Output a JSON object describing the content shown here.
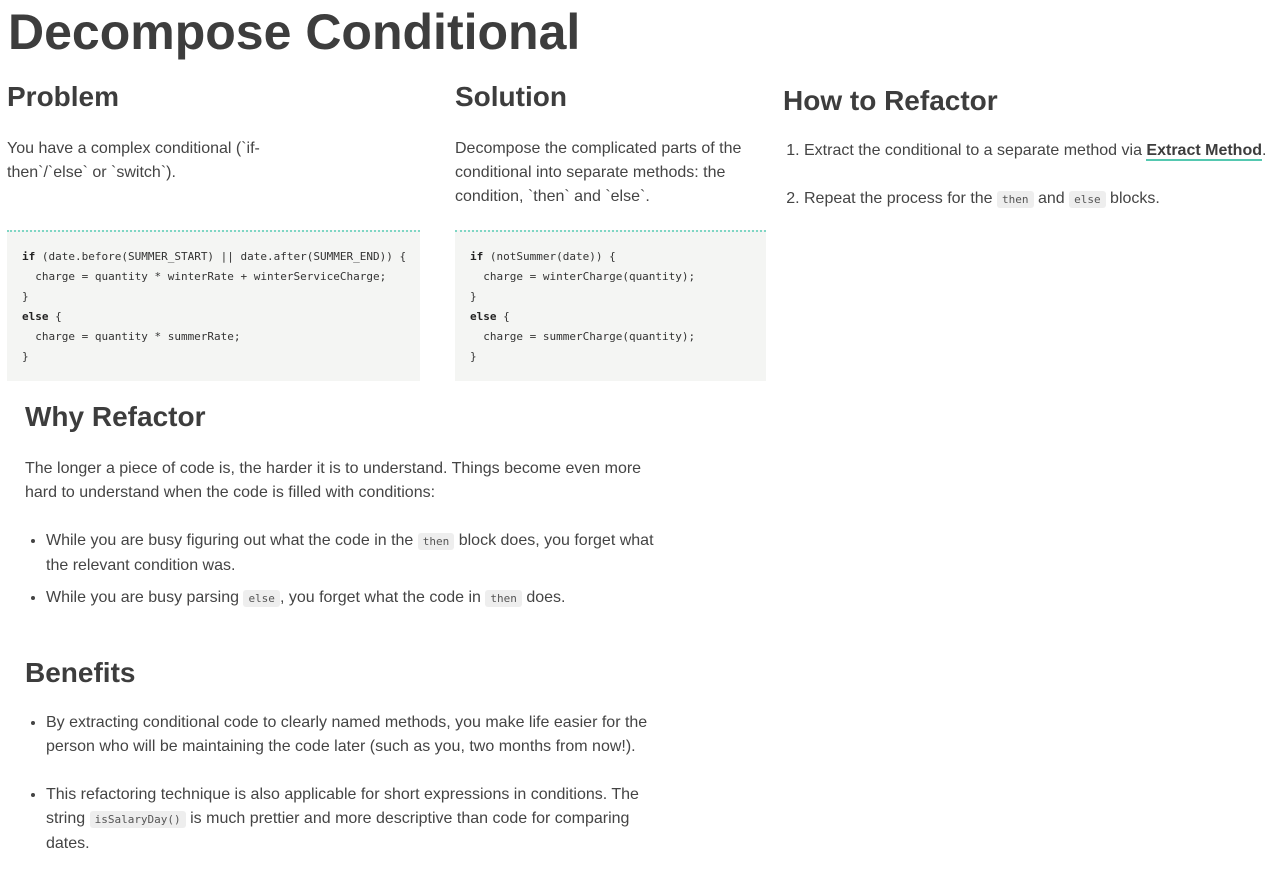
{
  "page_title": "Decompose Conditional",
  "problem": {
    "heading": "Problem",
    "text": "You have a complex conditional (`if-then`/`else` or `switch`).",
    "code": [
      {
        "kw": "if",
        "rest": " (date.before(SUMMER_START) || date.after(SUMMER_END)) {"
      },
      {
        "kw": "",
        "rest": "  charge = quantity * winterRate + winterServiceCharge;"
      },
      {
        "kw": "",
        "rest": "}"
      },
      {
        "kw": "else",
        "rest": " {"
      },
      {
        "kw": "",
        "rest": "  charge = quantity * summerRate;"
      },
      {
        "kw": "",
        "rest": "}"
      }
    ]
  },
  "solution": {
    "heading": "Solution",
    "text": "Decompose the complicated parts of the conditional into separate methods: the condition, `then` and `else`.",
    "code": [
      {
        "kw": "if",
        "rest": " (notSummer(date)) {"
      },
      {
        "kw": "",
        "rest": "  charge = winterCharge(quantity);"
      },
      {
        "kw": "",
        "rest": "}"
      },
      {
        "kw": "else",
        "rest": " {"
      },
      {
        "kw": "",
        "rest": "  charge = summerCharge(quantity);"
      },
      {
        "kw": "",
        "rest": "}"
      }
    ]
  },
  "how_to": {
    "heading": "How to Refactor",
    "step1_text": "Extract the conditional to a separate method via ",
    "step1_link": "Extract Method",
    "step1_end": ".",
    "step2_a": "Repeat the process for the ",
    "step2_code1": "then",
    "step2_b": " and ",
    "step2_code2": "else",
    "step2_c": " blocks."
  },
  "why": {
    "heading": "Why Refactor",
    "text": "The longer a piece of code is, the harder it is to understand. Things become even more hard to understand when the code is filled with conditions:",
    "b1_a": "While you are busy figuring out what the code in the ",
    "b1_code": "then",
    "b1_b": " block does, you forget what the relevant condition was.",
    "b2_a": "While you are busy parsing ",
    "b2_code1": "else",
    "b2_b": ", you forget what the code in ",
    "b2_code2": "then",
    "b2_c": " does."
  },
  "benefits": {
    "heading": "Benefits",
    "b1": "By extracting conditional code to clearly named methods, you make life easier for the person who will be maintaining the code later (such as you, two months from now!).",
    "b2_a": "This refactoring technique is also applicable for short expressions in conditions. The string ",
    "b2_code": "isSalaryDay()",
    "b2_b": " is much prettier and more descriptive than code for comparing dates."
  }
}
